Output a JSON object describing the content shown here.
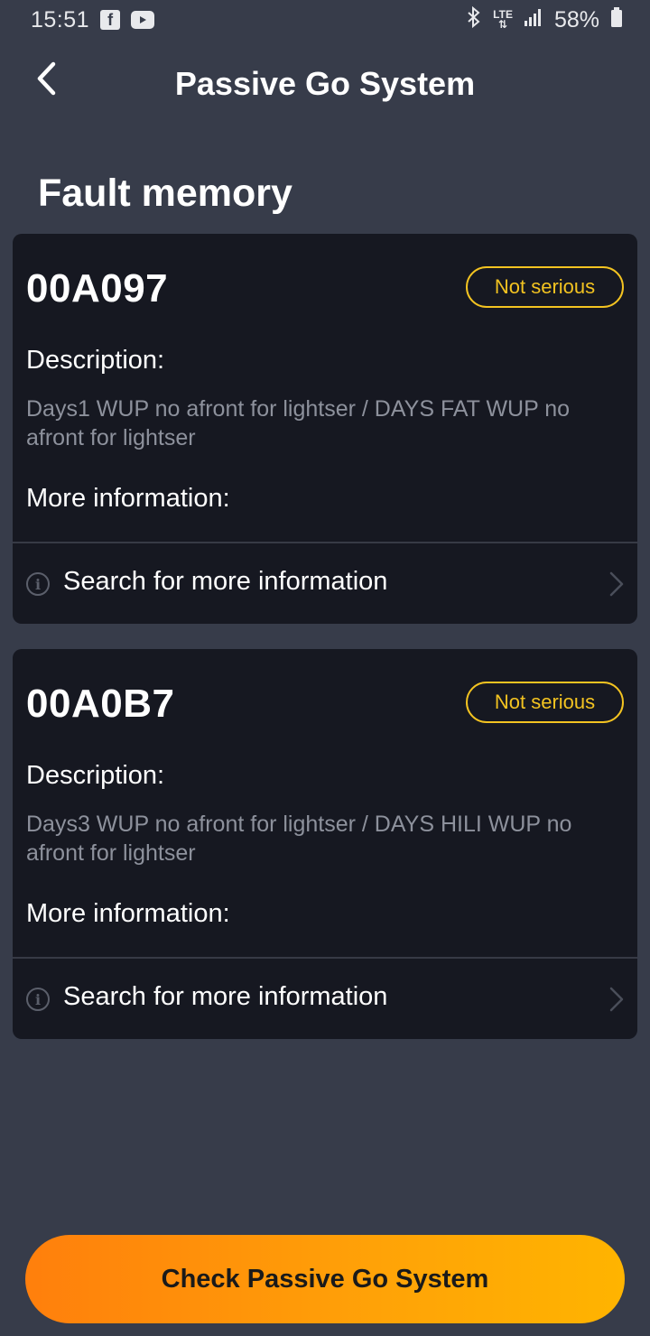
{
  "status_bar": {
    "time": "15:51",
    "app_icons": [
      "facebook-icon",
      "youtube-icon"
    ],
    "network": "LTE",
    "battery": "58%"
  },
  "header": {
    "title": "Passive Go System",
    "back_icon": "chevron-left-icon"
  },
  "section_title": "Fault memory",
  "faults": [
    {
      "code": "00A097",
      "severity": "Not serious",
      "description_label": "Description:",
      "description": "Days1 WUP no afront for lightser / DAYS FAT WUP no afront for lightser",
      "more_label": "More information:",
      "search_label": "Search for more information"
    },
    {
      "code": "00A0B7",
      "severity": "Not serious",
      "description_label": "Description:",
      "description": "Days3 WUP no afront for lightser / DAYS HILI WUP no afront for lightser",
      "more_label": "More information:",
      "search_label": "Search for more information"
    }
  ],
  "cta": {
    "label": "Check Passive Go System"
  },
  "colors": {
    "background": "#373c4a",
    "card": "#161821",
    "badge": "#f3c321",
    "cta_start": "#ff7f0c",
    "cta_end": "#ffb400"
  }
}
